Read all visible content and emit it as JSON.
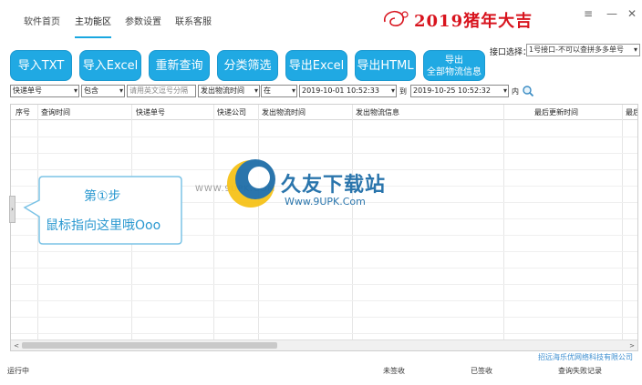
{
  "nav": {
    "items": [
      "软件首页",
      "主功能区",
      "参数设置",
      "联系客服"
    ],
    "active_index": 1
  },
  "brand": {
    "text": "2019猪年大吉"
  },
  "window_controls": {
    "minimize": "≡",
    "restore": "—",
    "close": "✕"
  },
  "toolbar": {
    "buttons": [
      "导入TXT",
      "导入Excel",
      "重新查询",
      "分类筛选",
      "导出Excel",
      "导出HTML"
    ],
    "export_all_line1": "导出",
    "export_all_line2": "全部物流信息"
  },
  "port": {
    "label": "接口选择：",
    "value": "1号接口-不可以查拼多多单号"
  },
  "filters": {
    "field": "快递单号",
    "match": "包含",
    "text_placeholder": "请用英文逗号分隔",
    "time_field": "发出物流时间",
    "time_mode": "在",
    "date_from": "2019-10-01 10:52:33",
    "to_label": "到",
    "date_to": "2019-10-25 10:52:32",
    "within_label": "内"
  },
  "grid": {
    "columns": [
      "序号",
      "查询时间",
      "快递单号",
      "快递公司",
      "发出物流时间",
      "发出物流信息",
      "最后更新时间",
      "最后更新物流"
    ]
  },
  "scrollbar": {
    "left": "<",
    "right": ">"
  },
  "watermark": {
    "title": "久友下载站",
    "url": "Www.9UPK.Com",
    "url_left": "WWW.9UPK.COM"
  },
  "callout": {
    "step": "第①步",
    "tip": "鼠标指向这里哦Ooo"
  },
  "footer": {
    "company_link": "招远海乐优网络科技有限公司",
    "status_running": "运行中",
    "not_signed": "未签收",
    "signed": "已签收",
    "query_failed": "查询失败记录"
  },
  "colors": {
    "accent": "#20a9e3",
    "brand_red": "#d8141e",
    "link": "#3c8ed0"
  }
}
